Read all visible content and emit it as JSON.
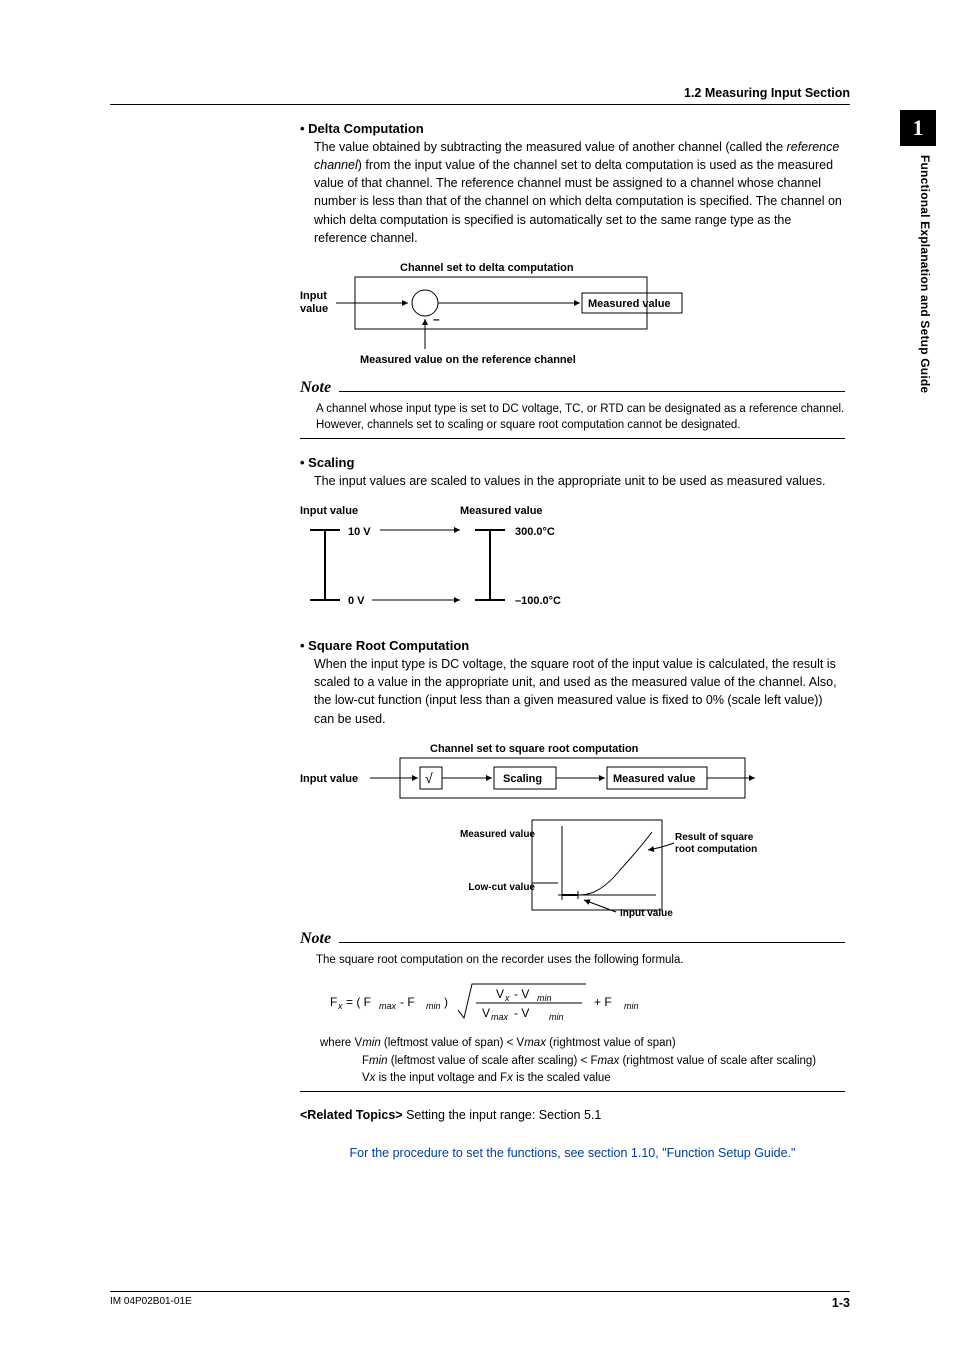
{
  "header": {
    "section": "1.2  Measuring Input Section"
  },
  "sideTab": {
    "chapter": "1",
    "label": "Functional Explanation and Setup Guide"
  },
  "delta": {
    "heading": "Delta Computation",
    "body1": "The value obtained by subtracting the measured value of another channel (called the ",
    "body1_em": "reference channel",
    "body1_cont": ") from the input value of the channel set to delta computation is used as the measured value of that channel. The reference channel must be assigned to a channel whose channel number is less than that of the channel on which delta computation is specified. The channel on which delta computation is specified is automatically set to the same range type as the reference channel.",
    "fig": {
      "title": "Channel set to delta computation",
      "inputLabel": "Input value",
      "minus": "–",
      "measuredLabel": "Measured value",
      "refLabel": "Measured value on the reference channel"
    },
    "note": "A channel whose input type is set to DC voltage, TC, or RTD can be designated as a reference channel. However, channels set to scaling or square root computation cannot be designated."
  },
  "scaling": {
    "heading": "Scaling",
    "body": "The input values are scaled to values in the appropriate unit to be used as measured values.",
    "fig": {
      "inLabel": "Input value",
      "outLabel": "Measured value",
      "inHi": "10 V",
      "inLo": "0 V",
      "outHi": "300.0°C",
      "outLo": "–100.0°C"
    }
  },
  "sqrt": {
    "heading": "Square Root Computation",
    "body": "When the input type is DC voltage, the square root of the input value is calculated, the result is scaled to a value in the appropriate unit, and used as the measured value of the channel. Also, the low-cut function (input less than a given measured value is fixed to 0% (scale left value)) can be used.",
    "fig": {
      "title": "Channel set to square root computation",
      "inputLabel": "Input value",
      "sqrtSym": "√",
      "scalingLabel": "Scaling",
      "measuredLabel": "Measured value",
      "mvAxis": "Measured value",
      "lowcut": "Low-cut value",
      "result": "Result of square root computation",
      "ivAxis": "Input value"
    },
    "note": {
      "intro": "The square root computation on the recorder uses the following formula.",
      "formula_lhs": "F",
      "formula_x": "x",
      "eq": " = ( F",
      "max": "max",
      "minus": " -  F",
      "min": "min",
      "paren": " ) ",
      "frac_num_a": "V",
      "frac_num_b": " - V",
      "frac_den_a": "V",
      "frac_den_b": "  -   V",
      "plusF": "   + F",
      "where1a": "where V",
      "where1b": " (leftmost value of span) < V",
      "where1c": " (rightmost value of span)",
      "where2a": "F",
      "where2b": " (leftmost value of scale after scaling) < F",
      "where2c": " (rightmost value of scale after scaling)",
      "where3a": "V",
      "where3b": " is the input voltage and F",
      "where3c": " is the scaled value"
    }
  },
  "noteLabel": "Note",
  "related": {
    "label": "<Related Topics>",
    "text": "  Setting the input range: Section 5.1"
  },
  "blue": "For the procedure to set the functions, see section 1.10, \"Function Setup Guide.\"",
  "footer": {
    "doc": "IM 04P02B01-01E",
    "page": "1-3"
  }
}
